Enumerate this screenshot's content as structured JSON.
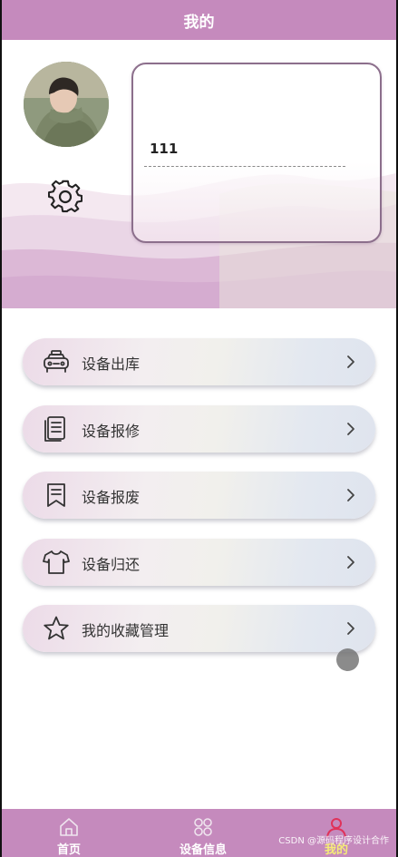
{
  "header": {
    "title": "我的"
  },
  "profile": {
    "username": "111"
  },
  "menu": {
    "items": [
      {
        "label": "设备出库",
        "icon": "car-icon"
      },
      {
        "label": "设备报修",
        "icon": "document-icon"
      },
      {
        "label": "设备报废",
        "icon": "bookmark-document-icon"
      },
      {
        "label": "设备归还",
        "icon": "shirt-icon"
      },
      {
        "label": "我的收藏管理",
        "icon": "star-icon"
      }
    ]
  },
  "tabbar": {
    "tabs": [
      {
        "label": "首页",
        "icon": "home-icon",
        "active": false
      },
      {
        "label": "设备信息",
        "icon": "grid-icon",
        "active": false
      },
      {
        "label": "我的",
        "icon": "user-icon",
        "active": true
      }
    ]
  },
  "watermark": "CSDN @源码程序设计合作",
  "colors": {
    "header_bg": "#c58abd",
    "tab_active_icon": "#e0325a",
    "tab_label": "#ffffff",
    "tab_label_active": "#f5ec77"
  }
}
